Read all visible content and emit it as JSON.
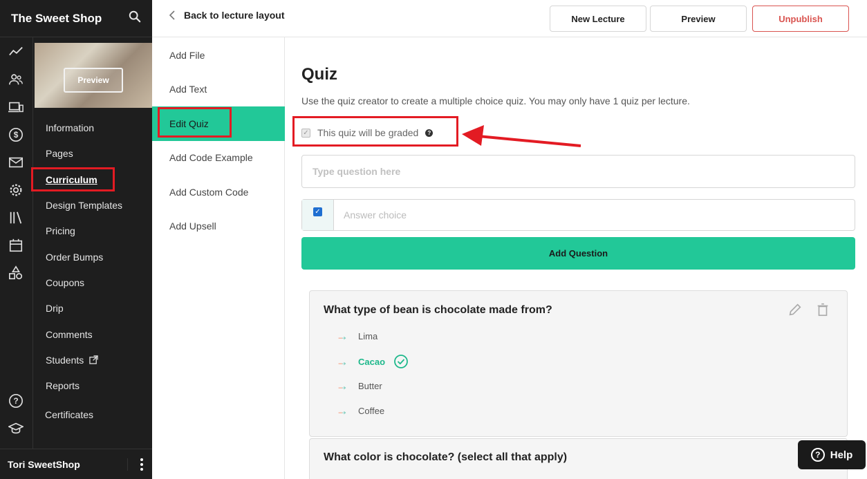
{
  "brand": {
    "title": "The Sweet Shop"
  },
  "thumbnail": {
    "preview_label": "Preview"
  },
  "sidebar": {
    "items": [
      {
        "label": "Information"
      },
      {
        "label": "Pages"
      },
      {
        "label": "Curriculum",
        "active": true
      },
      {
        "label": "Design Templates"
      },
      {
        "label": "Pricing"
      },
      {
        "label": "Order Bumps"
      },
      {
        "label": "Coupons"
      },
      {
        "label": "Drip"
      },
      {
        "label": "Comments"
      },
      {
        "label": "Students"
      },
      {
        "label": "Reports"
      },
      {
        "label": "Certificates"
      }
    ],
    "rail_icons": [
      "analytics-icon",
      "users-icon",
      "devices-icon",
      "dollar-icon",
      "mail-icon",
      "gear-icon",
      "library-icon",
      "calendar-icon",
      "shapes-icon",
      "help-circle-icon",
      "graduation-cap-icon"
    ],
    "footer_user": "Tori SweetShop"
  },
  "topbar": {
    "back_label": "Back to lecture layout",
    "new_lecture": "New Lecture",
    "preview": "Preview",
    "unpublish": "Unpublish"
  },
  "blocks": [
    {
      "label": "Add File"
    },
    {
      "label": "Add Text"
    },
    {
      "label": "Edit Quiz",
      "active": true
    },
    {
      "label": "Add Code Example"
    },
    {
      "label": "Add Custom Code"
    },
    {
      "label": "Add Upsell"
    }
  ],
  "quiz": {
    "title": "Quiz",
    "description": "Use the quiz creator to create a multiple choice quiz. You may only have 1 quiz per lecture.",
    "graded_label": "This quiz will be graded",
    "graded_checked": true,
    "question_placeholder": "Type question here",
    "answer_placeholder": "Answer choice",
    "answer_checked": true,
    "add_question": "Add Question",
    "questions": [
      {
        "title": "What type of bean is chocolate made from?",
        "choices": [
          {
            "text": "Lima",
            "correct": false
          },
          {
            "text": "Cacao",
            "correct": true
          },
          {
            "text": "Butter",
            "correct": false
          },
          {
            "text": "Coffee",
            "correct": false
          }
        ]
      },
      {
        "title": "What color is chocolate? (select all that apply)",
        "choices": []
      }
    ]
  },
  "help": {
    "label": "Help"
  },
  "colors": {
    "accent": "#22c898",
    "sidebar_bg": "#1e1e1e",
    "annotation": "#e31b23",
    "danger": "#d9534f"
  }
}
